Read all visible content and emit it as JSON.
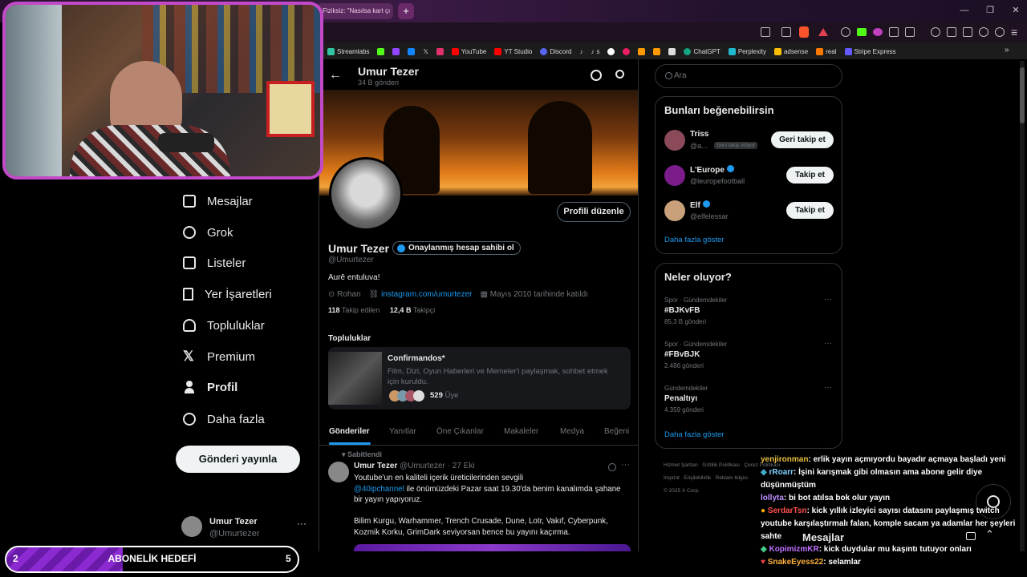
{
  "browser": {
    "tab_title": "Fiziksiz: \"Nasılsa kart çı",
    "window_minimize": "—",
    "window_restore": "❐",
    "window_close": "✕"
  },
  "bookmarks": [
    {
      "label": "Streamlabs",
      "color": "#31c3a2"
    },
    {
      "label": "",
      "color": "#53fc18"
    },
    {
      "label": "",
      "color": "#9146ff"
    },
    {
      "label": "",
      "color": "#1185fe"
    },
    {
      "label": "",
      "color": "#ffffff"
    },
    {
      "label": "",
      "color": "#e1306c"
    },
    {
      "label": "YouTube",
      "color": "#ff0000"
    },
    {
      "label": "YT Studio",
      "color": "#ff0000"
    },
    {
      "label": "Discord",
      "color": "#5865f2"
    },
    {
      "label": "",
      "color": "#ffffff"
    },
    {
      "label": "s",
      "color": "#ffffff"
    },
    {
      "label": "",
      "color": "#ffffff"
    },
    {
      "label": "",
      "color": "#e91e63"
    },
    {
      "label": "",
      "color": "#ff9900"
    },
    {
      "label": "",
      "color": "#ff9900"
    },
    {
      "label": "",
      "color": "#ffffff"
    },
    {
      "label": "ChatGPT",
      "color": "#10a37f"
    },
    {
      "label": "Perplexity",
      "color": "#20b8cd"
    },
    {
      "label": "adsense",
      "color": "#fbbc04"
    },
    {
      "label": "real",
      "color": "#ff7a00"
    },
    {
      "label": "Stripe Express",
      "color": "#635bff"
    }
  ],
  "sidebar": {
    "items": [
      {
        "label": "Mesajlar",
        "icon": "envelope-icon"
      },
      {
        "label": "Grok",
        "icon": "grok-icon"
      },
      {
        "label": "Listeler",
        "icon": "list-icon"
      },
      {
        "label": "Yer İşaretleri",
        "icon": "bookmark-icon"
      },
      {
        "label": "Topluluklar",
        "icon": "people-icon"
      },
      {
        "label": "Premium",
        "icon": "x-logo-icon"
      },
      {
        "label": "Profil",
        "icon": "person-icon"
      },
      {
        "label": "Daha fazla",
        "icon": "more-circle-icon"
      }
    ],
    "post_button": "Gönderi yayınla",
    "account": {
      "name": "Umur Tezer",
      "handle": "@Umurtezer",
      "more": "···"
    }
  },
  "profile": {
    "header_name": "Umur Tezer",
    "post_count": "34 B gönderi",
    "edit_button": "Profili düzenle",
    "name": "Umur Tezer",
    "verified_badge": "Onaylanmış hesap sahibi ol",
    "handle": "@Umurtezer",
    "bio": "Aurē entuluva!",
    "location": "Rohan",
    "link": "instagram.com/umurtezer",
    "joined": "Mayıs 2010 tarihinde katıldı",
    "following_count": "118",
    "following_label": "Takip edilen",
    "followers_count": "12,4 B",
    "followers_label": "Takipçi",
    "communities_title": "Topluluklar",
    "community": {
      "name": "Confirmandos*",
      "desc": "Film, Dizi, Oyun Haberleri ve Memeler'i paylaşmak, sohbet etmek için kuruldu.",
      "members_count": "529",
      "members_label": "Üye"
    },
    "tabs": [
      "Gönderiler",
      "Yanıtlar",
      "Öne Çıkanlar",
      "Makaleler",
      "Medya",
      "Beğeni"
    ],
    "pinned_label": "Sabitlendi",
    "post": {
      "name": "Umur Tezer",
      "handle": "@Umurtezer",
      "date": "· 27 Eki",
      "line1": "Youtube'un en kaliteli içerik üreticilerinden sevgili",
      "mention": "@40ipchannel",
      "line2": " ile önümüzdeki Pazar saat 19.30'da benim kanalımda şahane bir yayın yapıyoruz.",
      "line3": "Bilim Kurgu, Warhammer, Trench Crusade, Dune, Lotr, Vakıf, Cyberpunk, Kozmik Korku, GrimDark seviyorsan bence bu yayını kaçırma."
    }
  },
  "right": {
    "search_placeholder": "Ara",
    "suggest_title": "Bunları beğenebilirsin",
    "suggestions": [
      {
        "name": "Triss",
        "handle": "@a...",
        "tag": "Seni takip ediyor",
        "button": "Geri takip et",
        "avatar_color": "#8a4a5a"
      },
      {
        "name": "L'Europe",
        "handle": "@leuropefootball",
        "tag": "",
        "button": "Takip et",
        "avatar_color": "#7a1d8a"
      },
      {
        "name": "Elf",
        "handle": "@elfelessar",
        "tag": "",
        "button": "Takip et",
        "avatar_color": "#c9a07a"
      }
    ],
    "show_more": "Daha fazla göster",
    "trends_title": "Neler oluyor?",
    "trends": [
      {
        "context": "Spor · Gündemdekiler",
        "tag": "#BJKvFB",
        "count": "85,3 B gönderi"
      },
      {
        "context": "Spor · Gündemdekiler",
        "tag": "#FBvBJK",
        "count": "2.486 gönderi"
      },
      {
        "context": "Gündemdekiler",
        "tag": "Penaltıyı",
        "count": "4.359 gönderi"
      }
    ],
    "trends_more": "Daha fazla göster",
    "footer": [
      "Hizmet Şartları",
      "Gizlilik Politikası",
      "Çerez Politikası",
      "İmprint",
      "Erişilebilirlik",
      "Reklam bilgisi",
      "© 2025 X Corp."
    ]
  },
  "overlay": {
    "goal_left": "2",
    "goal_title": "ABONELİK HEDEFİ",
    "goal_right": "5",
    "goal_progress": 0.4,
    "messages_label": "Mesajlar",
    "chat": [
      {
        "user": "yenjironman",
        "color": "#e8c040",
        "text": ": erlik yayın açmıyordu bayadır açmaya başladı yeni"
      },
      {
        "user": "rRoarr",
        "color": "#7fd0ff",
        "text": ": İşini karışmak gibi olmasın ama abone gelir diye düşünmüştüm"
      },
      {
        "user": "lollyta",
        "color": "#c090ff",
        "text": ": bi bot atılsa bok olur yayın"
      },
      {
        "user": "SerdarTsn",
        "color": "#ff5050",
        "text": ": kick yıllık izleyici sayısı datasını paylaşmış twitch youtube karşılaştırmalı falan, komple sacam ya adamlar her şeyleri sahte"
      },
      {
        "user": "KopimizmKR",
        "color": "#c070ff",
        "text": ": kick duydular mu kaşıntı tutuyor onları"
      },
      {
        "user": "SnakeEyess22",
        "color": "#ffb040",
        "text": ": selamlar"
      }
    ]
  }
}
